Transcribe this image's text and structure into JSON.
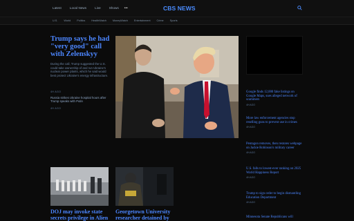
{
  "header": {
    "nav": [
      "Latest",
      "Local News",
      "Live",
      "Shows"
    ],
    "more": "•••",
    "logo": "CBS NEWS"
  },
  "subnav": [
    "U.S.",
    "World",
    "Politics",
    "HealthWatch",
    "MoneyWatch",
    "Entertainment",
    "Crime",
    "Sports"
  ],
  "lead": {
    "title": "Trump says he had \"very good\" call with Zelenskyy",
    "description": "During the call, Trump suggested the U.S. could take ownership of and run Ukraine's nuclear power plants, which he said would best protect Ukraine's energy infrastructure.",
    "tag": "4H AGO",
    "related_title": "Russia strikes Ukraine hospital hours after Trump speaks with Putin",
    "related_tag": "4H AGO"
  },
  "right_headlines": [
    {
      "title": "Google finds 12,000 fake listings on Google Maps, sues alleged network of scammers",
      "tag": "4H AGO"
    },
    {
      "title": "More law enforcement agencies stop reselling guns to prevent use in crimes",
      "tag": "4H AGO"
    },
    {
      "title": "Pentagon removes, then restores webpage on Jackie Robinson's military career",
      "tag": "4H AGO"
    },
    {
      "title": "U.S. falls to lowest-ever ranking on 2025 World Happiness Report",
      "tag": "4H AGO"
    },
    {
      "title": "Trump to sign order to begin dismantling Education Department",
      "tag": "4H AGO"
    },
    {
      "title": "Minnesota Senate Republicans will",
      "tag": ""
    }
  ],
  "bottom_stories": [
    {
      "title": "DOJ may invoke state secrets privilege in Alien"
    },
    {
      "title": "Georgetown University researcher detained by"
    }
  ],
  "colors": {
    "link": "#4c86ff",
    "background": "#0b0b0b",
    "muted": "#6e87a8"
  }
}
